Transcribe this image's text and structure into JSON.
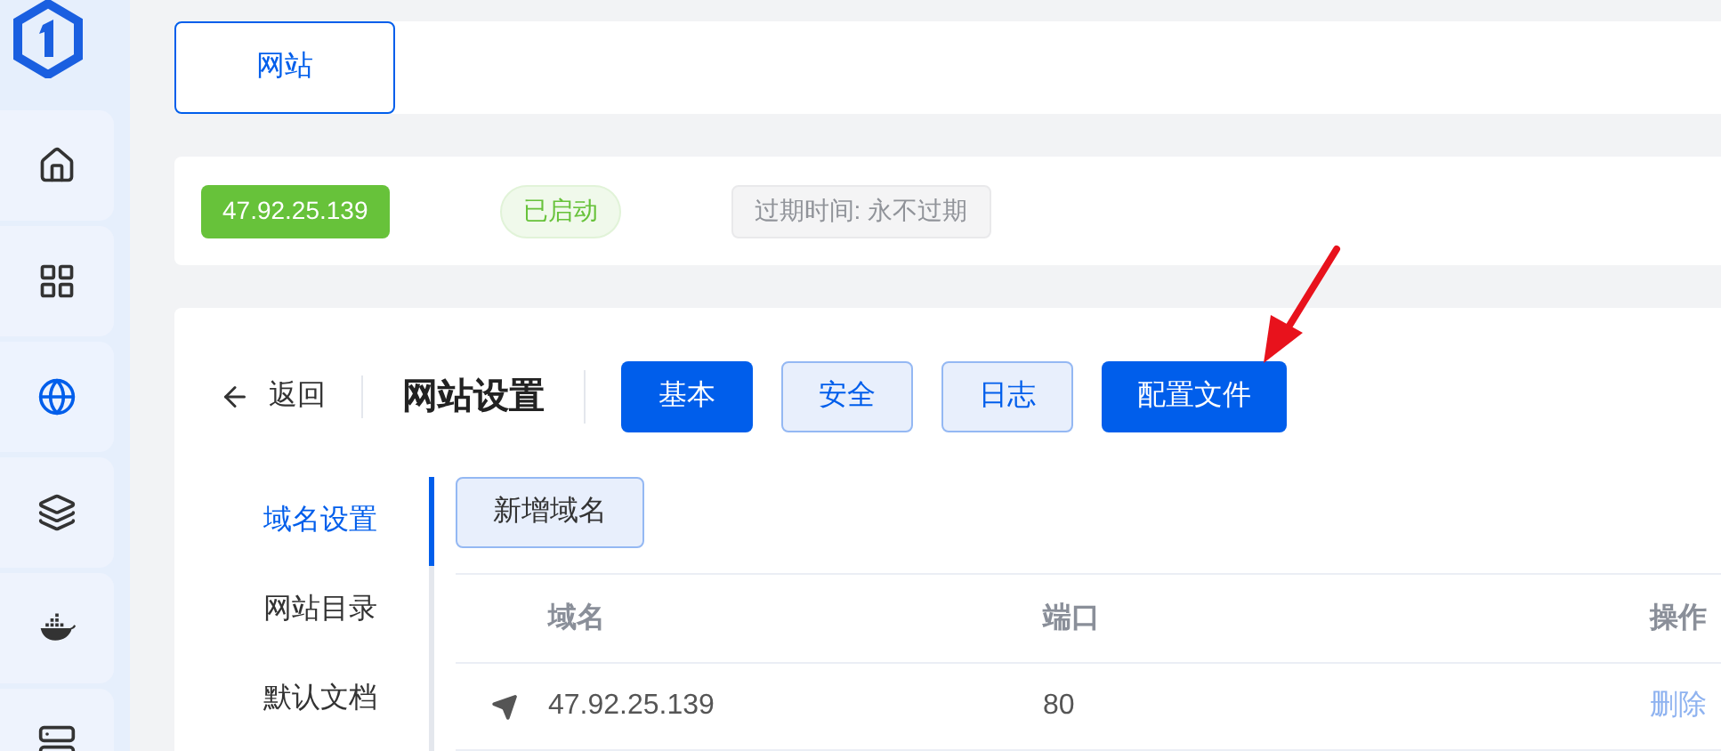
{
  "nav": [
    {
      "kind": "home",
      "selected": false
    },
    {
      "kind": "grid",
      "selected": false
    },
    {
      "kind": "globe",
      "selected": true
    },
    {
      "kind": "layers",
      "selected": false
    },
    {
      "kind": "docker",
      "selected": false
    },
    {
      "kind": "server",
      "selected": false
    }
  ],
  "top_tabs": [
    {
      "label": "网站",
      "selected": true
    }
  ],
  "info": {
    "address": "47.92.25.139",
    "status": "已启动",
    "expiry": "过期时间: 永不过期"
  },
  "header": {
    "back": "返回",
    "title": "网站设置"
  },
  "tabs": [
    {
      "label": "基本",
      "selected": true
    },
    {
      "label": "安全",
      "selected": false
    },
    {
      "label": "日志",
      "selected": false
    },
    {
      "label": "配置文件",
      "selected": true
    }
  ],
  "side_menu": [
    {
      "label": "域名设置",
      "selected": true
    },
    {
      "label": "网站目录",
      "selected": false
    },
    {
      "label": "默认文档",
      "selected": false
    }
  ],
  "add_button": "新增域名",
  "table": {
    "columns": [
      "域名",
      "端口",
      "操作"
    ],
    "rows": [
      {
        "domain": "47.92.25.139",
        "port": "80",
        "action": "删除"
      }
    ]
  }
}
